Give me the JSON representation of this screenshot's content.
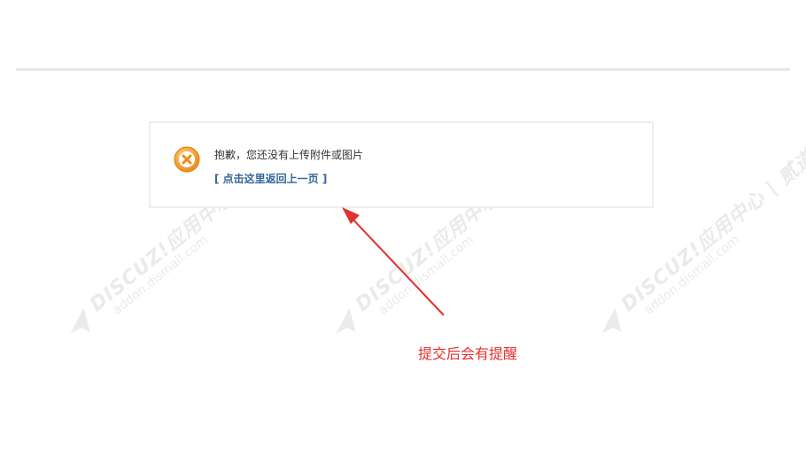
{
  "message": {
    "text": "抱歉，您还没有上传附件或图片",
    "back_link": "[ 点击这里返回上一页 ]",
    "icon": "error-x-icon"
  },
  "watermark": {
    "brand": "DISCUZ!应用中心 | 贰道®",
    "domain": "addon.dismall.com"
  },
  "annotation": {
    "note": "提交后会有提醒",
    "color": "#e2312e"
  },
  "colors": {
    "link": "#336699",
    "icon_fill": "#f4a43a",
    "divider": "#e8e8e8"
  }
}
